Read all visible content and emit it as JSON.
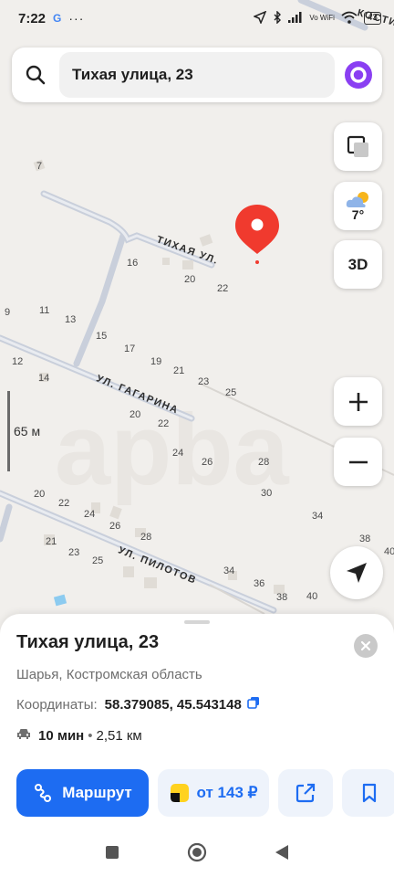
{
  "status_bar": {
    "time": "7:22",
    "google_badge": "G",
    "more": "···",
    "signal_label": "Vo WiFi",
    "battery": "43"
  },
  "search": {
    "query": "Тихая улица, 23"
  },
  "map": {
    "weather_temp": "7°",
    "btn_3d": "3D",
    "scale_label": "65 м",
    "streets": {
      "tikhaya": "ТИХАЯ УЛ.",
      "gagarina": "УЛ. ГАГАРИНА",
      "pilotov": "УЛ. ПИЛОТОВ",
      "corner": "КОСТИ"
    },
    "house_numbers": [
      "7",
      "16",
      "20",
      "22",
      "9",
      "11",
      "13",
      "15",
      "17",
      "19",
      "21",
      "23",
      "25",
      "12",
      "14",
      "20",
      "22",
      "24",
      "26",
      "28",
      "30",
      "20",
      "22",
      "24",
      "26",
      "28",
      "21",
      "23",
      "25",
      "34",
      "36",
      "38",
      "34",
      "38",
      "40",
      "40"
    ]
  },
  "sheet": {
    "title": "Тихая улица, 23",
    "subtitle": "Шарья, Костромская область",
    "coords_label": "Координаты:",
    "coords_value": "58.379085, 45.543148",
    "route_time": "10 мин",
    "route_sep": "•",
    "route_distance": "2,51 км",
    "route_button": "Маршрут",
    "taxi_button": "от 143 ₽"
  },
  "colors": {
    "accent": "#1d6cf2",
    "pin": "#f03a2e",
    "alice": "#8a3ff2"
  }
}
